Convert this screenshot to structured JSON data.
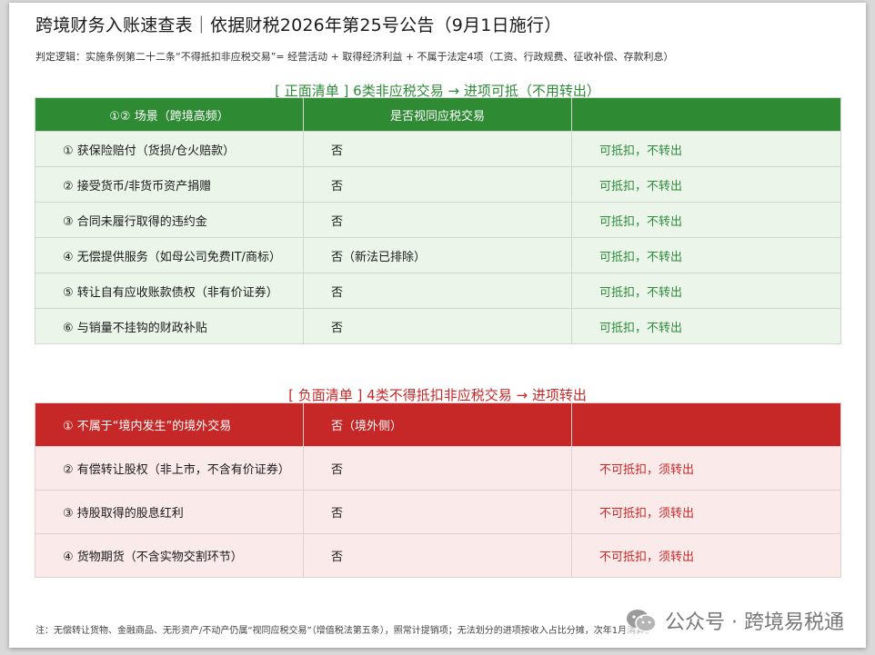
{
  "title": "跨境财务入账速查表｜依据财税2026年第25号公告（9月1日施行）",
  "logic": "判定逻辑：实施条例第二十二条“不得抵扣非应税交易”= 经营活动 + 取得经济利益 + 不属于法定4项（工资、行政规费、征收补偿、存款利息）",
  "positive": {
    "section_title": "[ 正面清单 ] 6类非应税交易 → 进项可抵（不用转出）",
    "headers": [
      "①② 场景（跨境高频）",
      "是否视同应税交易",
      ""
    ],
    "rows": [
      {
        "scene": "① 获保险赔付（货损/仓火赔款）",
        "taxable": "否",
        "result": "可抵扣，不转出"
      },
      {
        "scene": "② 接受货币/非货币资产捐赠",
        "taxable": "否",
        "result": "可抵扣，不转出"
      },
      {
        "scene": "③ 合同未履行取得的违约金",
        "taxable": "否",
        "result": "可抵扣，不转出"
      },
      {
        "scene": "④ 无偿提供服务（如母公司免费IT/商标）",
        "taxable": "否（新法已排除）",
        "result": "可抵扣，不转出"
      },
      {
        "scene": "⑤ 转让自有应收账款债权（非有价证券）",
        "taxable": "否",
        "result": "可抵扣，不转出"
      },
      {
        "scene": "⑥ 与销量不挂钩的财政补贴",
        "taxable": "否",
        "result": "可抵扣，不转出"
      }
    ]
  },
  "negative": {
    "section_title": "[ 负面清单 ] 4类不得抵扣非应税交易 → 进项转出",
    "head_row": {
      "scene": "① 不属于“境内发生”的境外交易",
      "taxable": "否（境外侧）",
      "result": ""
    },
    "rows": [
      {
        "scene": "② 有偿转让股权（非上市，不含有价证券）",
        "taxable": "否",
        "result": "不可抵扣，须转出"
      },
      {
        "scene": "③ 持股取得的股息红利",
        "taxable": "否",
        "result": "不可抵扣，须转出"
      },
      {
        "scene": "④ 货物期货（不含实物交割环节）",
        "taxable": "否",
        "result": "不可抵扣，须转出"
      }
    ]
  },
  "note": "注：无偿转让货物、金融商品、无形资产/不动产仍属“视同应税交易”（增值税法第五条），照常计提销项；无法划分的进项按收入占比分摊，次年1月清算。",
  "watermark": "公众号 · 跨境易税通",
  "colors": {
    "green": "#2f8a34",
    "red": "#c62828",
    "light_green": "#ebf5ea",
    "light_red": "#fbeaea"
  }
}
